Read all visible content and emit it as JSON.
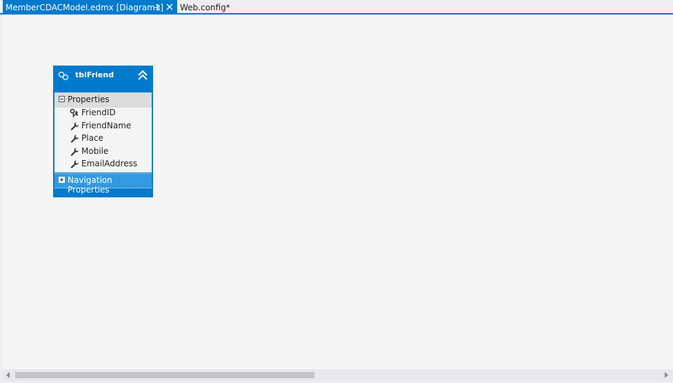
{
  "tabs": [
    {
      "label": "MemberCDACModel.edmx [Diagram1]",
      "active": true
    },
    {
      "label": "Web.config*",
      "active": false
    }
  ],
  "entity": {
    "title": "tblFriend",
    "properties_header": "Properties",
    "properties": [
      {
        "name": "FriendID",
        "icon": "key-icon"
      },
      {
        "name": "FriendName",
        "icon": "wrench-icon"
      },
      {
        "name": "Place",
        "icon": "wrench-icon"
      },
      {
        "name": "Mobile",
        "icon": "wrench-icon"
      },
      {
        "name": "EmailAddress",
        "icon": "wrench-icon"
      }
    ],
    "navigation_header": "Navigation Properties"
  },
  "colors": {
    "accent": "#007acc",
    "canvas": "#f5f5f5",
    "nav_highlight": "#3399e0"
  }
}
